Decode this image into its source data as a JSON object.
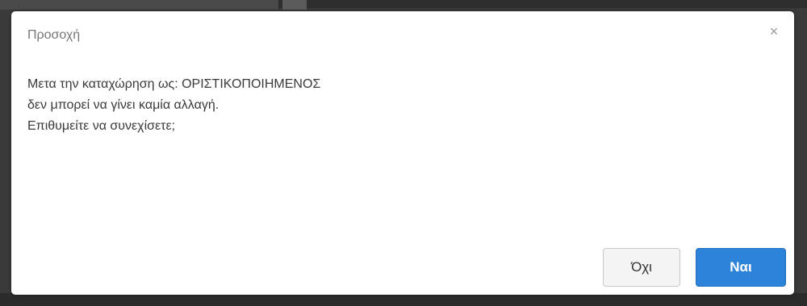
{
  "dialog": {
    "title": "Προσοχή",
    "close_glyph": "×",
    "message_lines": [
      "Μετα την καταχώρηση ως: ΟΡΙΣΤΙΚΟΠΟΙΗΜΕΝΟΣ",
      "δεν μπορεί να γίνει καμία αλλαγή.",
      "Επιθυμείτε να συνεχίσετε;"
    ],
    "buttons": {
      "no_label": "Όχι",
      "yes_label": "Ναι"
    }
  },
  "colors": {
    "primary": "#2d83d8",
    "title_text": "#777777",
    "body_text": "#3a3a3a"
  }
}
